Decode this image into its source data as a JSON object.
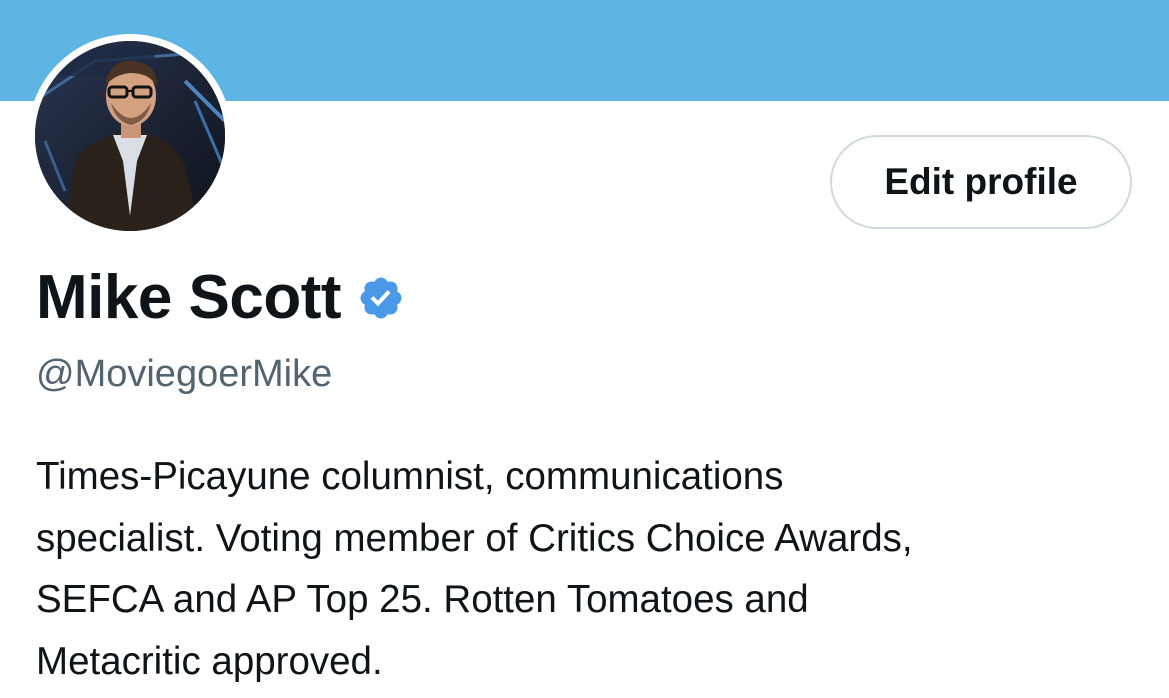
{
  "profile": {
    "banner_color": "#5db5e3",
    "avatar_icon": "profile-photo",
    "edit_button_label": "Edit profile",
    "display_name": "Mike Scott",
    "verified_icon": "verified-badge-icon",
    "verified_color": "#4a99e9",
    "handle": "@MoviegoerMike",
    "bio_lines": [
      "Times-Picayune columnist, communications",
      "specialist. Voting member of Critics Choice Awards,",
      "SEFCA and AP Top 25. Rotten Tomatoes and",
      "Metacritic approved."
    ]
  }
}
